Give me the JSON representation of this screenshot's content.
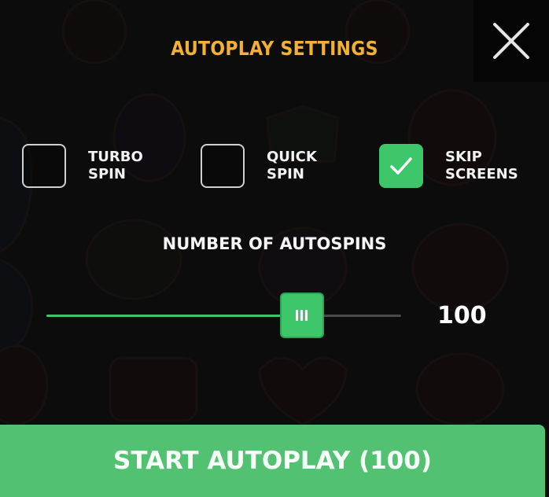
{
  "dialog": {
    "title": "AUTOPLAY SETTINGS"
  },
  "options": [
    {
      "label": "TURBO\nSPIN",
      "checked": false
    },
    {
      "label": "QUICK\nSPIN",
      "checked": false
    },
    {
      "label": "SKIP\nSCREENS",
      "checked": true
    }
  ],
  "autospins": {
    "heading": "NUMBER OF AUTOSPINS",
    "value": "100",
    "slider_fraction": 0.72
  },
  "start_button": {
    "label": "START AUTOPLAY (100)"
  },
  "icons": {
    "close": "close-icon",
    "check": "checkmark-icon",
    "grip": "slider-grip-icon"
  },
  "colors": {
    "accent_green": "#3ec76a",
    "button_green": "#52c272",
    "title_gold": "#f2b134",
    "background": "#0d0c0c"
  }
}
